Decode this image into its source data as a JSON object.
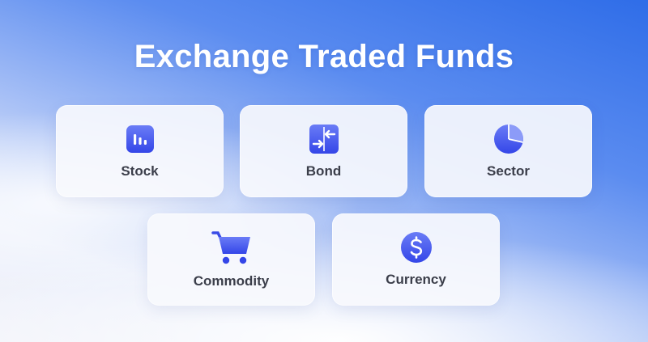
{
  "title": "Exchange Traded Funds",
  "accent_color": "#3f56f0",
  "cards": [
    {
      "label": "Stock",
      "icon": "bar-chart-icon"
    },
    {
      "label": "Bond",
      "icon": "exchange-arrows-icon"
    },
    {
      "label": "Sector",
      "icon": "pie-chart-icon"
    },
    {
      "label": "Commodity",
      "icon": "shopping-cart-icon"
    },
    {
      "label": "Currency",
      "icon": "dollar-coin-icon"
    }
  ]
}
